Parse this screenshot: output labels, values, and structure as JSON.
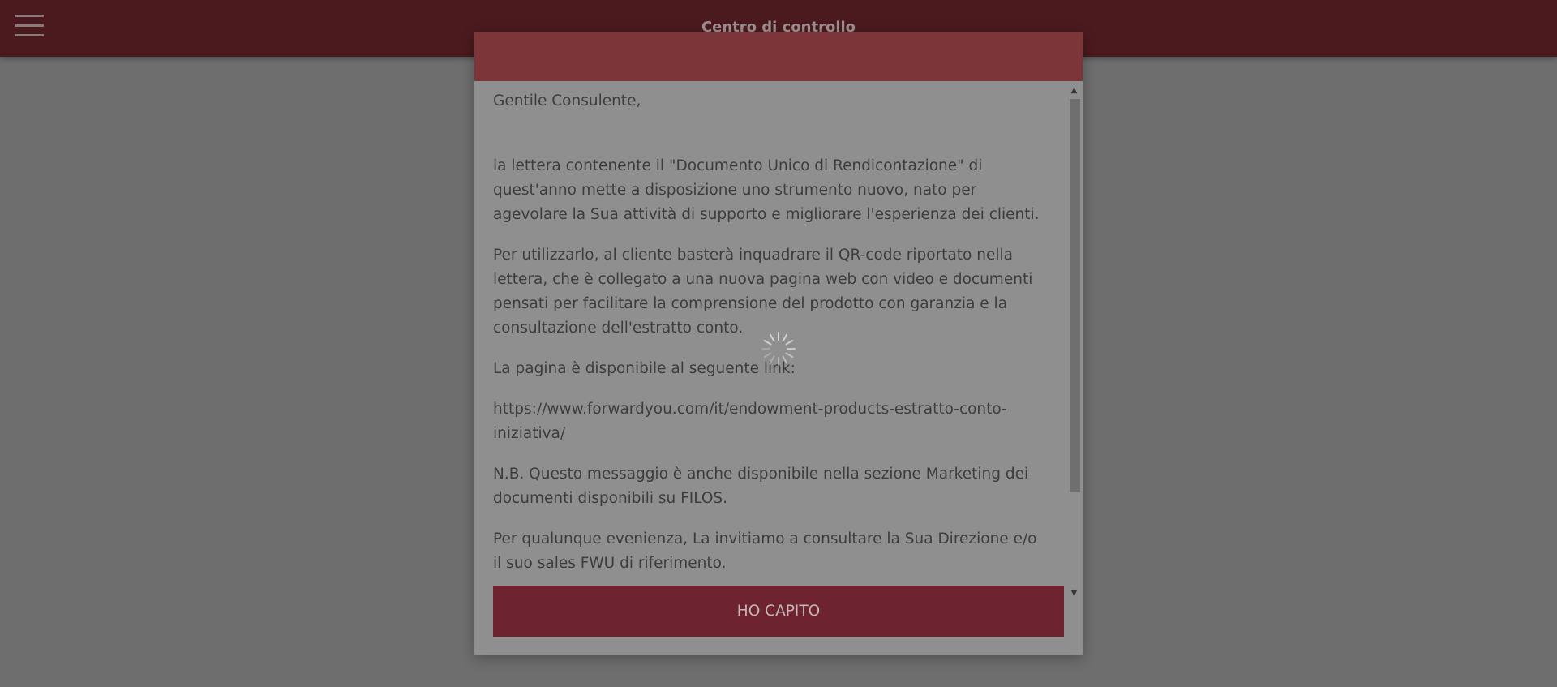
{
  "header": {
    "title": "Centro di controllo",
    "menu_icon": "hamburger-menu-icon"
  },
  "modal": {
    "paragraphs": [
      "Gentile Consulente,",
      "la lettera contenente il \"Documento Unico di Rendicontazione\" di quest'anno mette a disposizione uno strumento nuovo, nato per agevolare la Sua attività di supporto e migliorare l'esperienza dei clienti.",
      "Per utilizzarlo, al cliente basterà inquadrare il QR-code riportato nella lettera, che è collegato a una nuova pagina web con video e documenti pensati per facilitare la comprensione del prodotto con garanzia e la consultazione dell'estratto conto.",
      "La pagina è disponibile al seguente link:",
      "https://www.forwardyou.com/it/endowment-products-estratto-conto-iniziativa/",
      "N.B. Questo messaggio è anche disponibile nella sezione Marketing dei documenti disponibili su FILOS.",
      "Per qualunque evenienza, La invitiamo a consultare la Sua Direzione e/o il suo sales FWU di riferimento."
    ],
    "button_label": "HO CAPITO",
    "scroll_up_glyph": "▲",
    "scroll_down_glyph": "▼"
  },
  "colors": {
    "topbar": "#4a1a1e",
    "modal_header": "#7c3539",
    "button": "#6e2330",
    "overlay": "#6e6e6e"
  },
  "loading_indicator": "spinner-icon"
}
